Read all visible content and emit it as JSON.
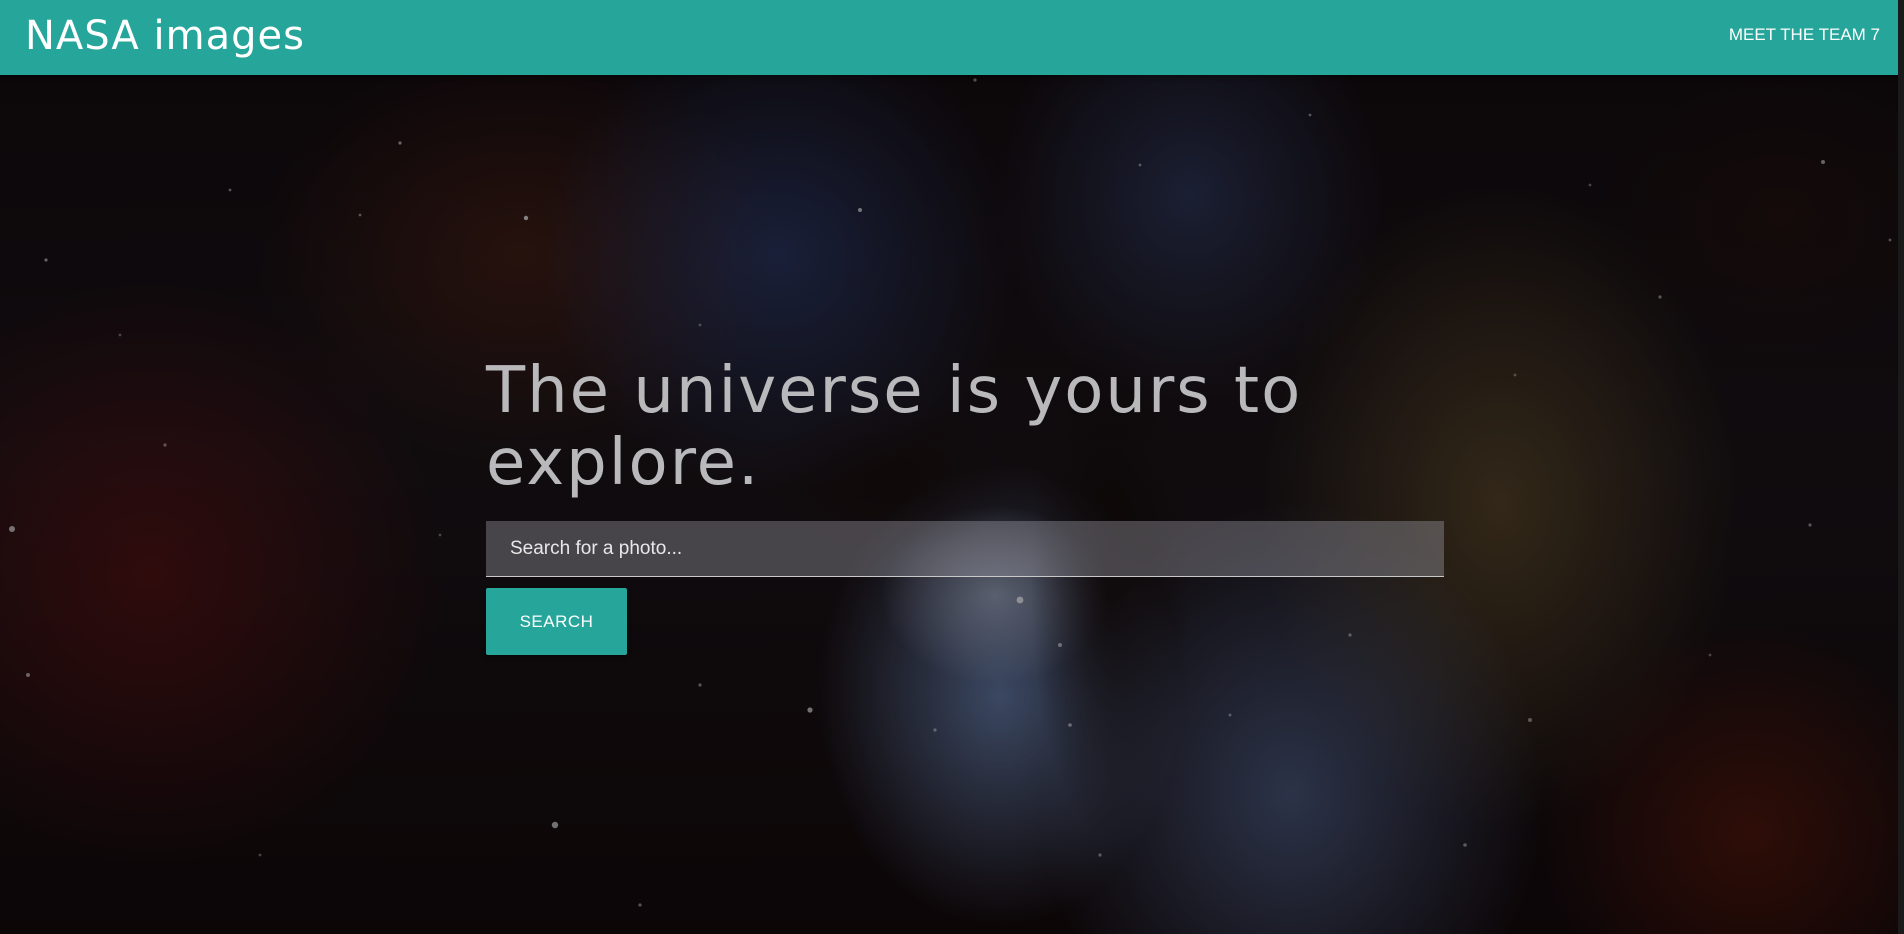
{
  "navbar": {
    "brand": "NASA images",
    "link": "MEET THE TEAM 7",
    "color": "#26a69a"
  },
  "hero": {
    "title": "The universe is yours to explore.",
    "search_placeholder": "Search for a photo...",
    "search_value": "",
    "search_button": "SEARCH"
  }
}
